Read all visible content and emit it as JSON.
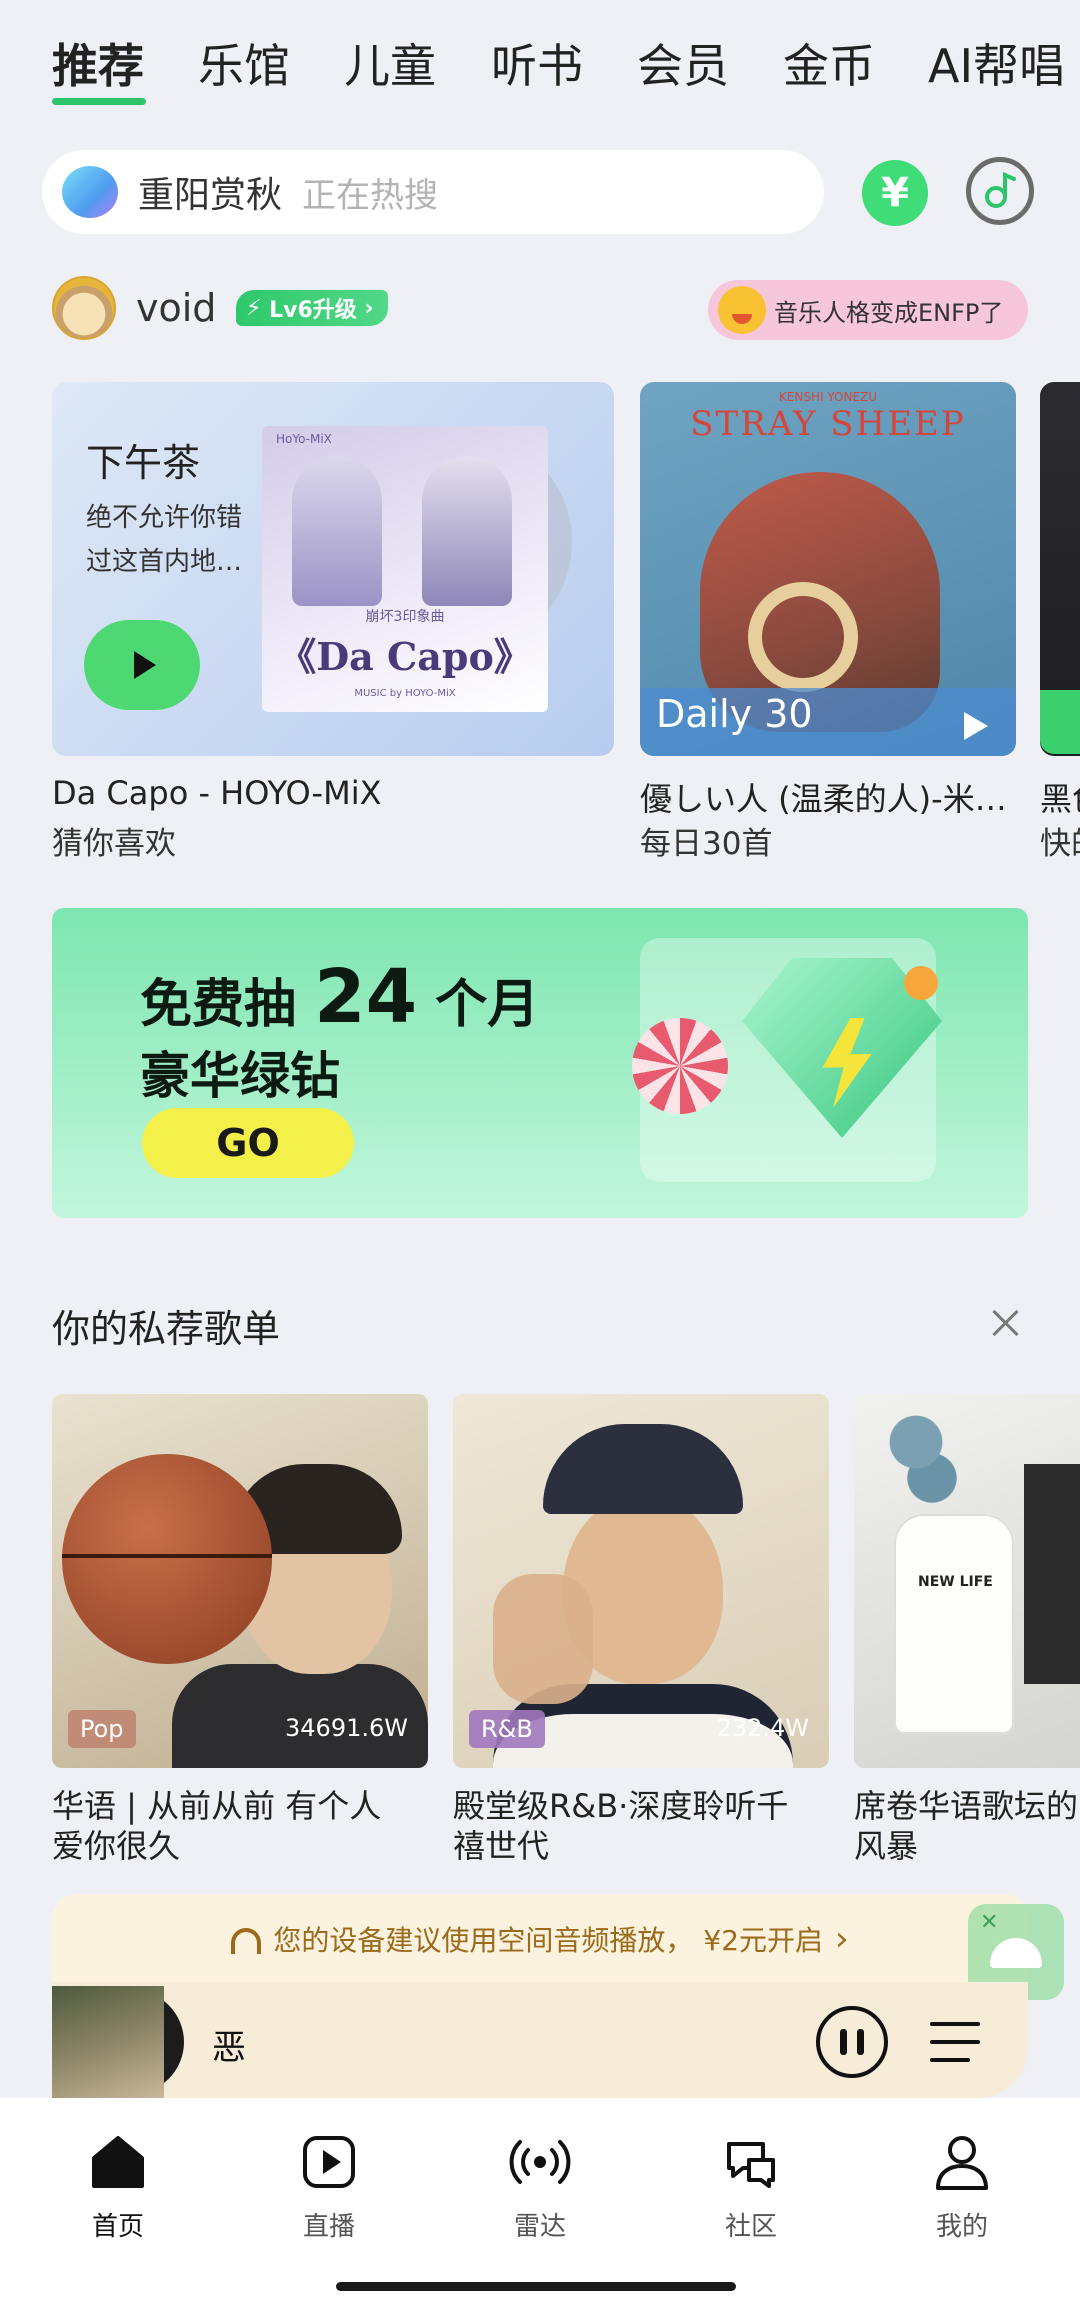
{
  "top_tabs": [
    "推荐",
    "乐馆",
    "儿童",
    "听书",
    "会员",
    "金币",
    "AI帮唱"
  ],
  "active_tab": "推荐",
  "search": {
    "keyword": "重阳赏秋",
    "hint": "正在热搜"
  },
  "coin_icon": "yen-icon",
  "user": {
    "name": "void",
    "level": "Lv6升级",
    "persona": "音乐人格变成ENFP了"
  },
  "cards": [
    {
      "title": "下午茶",
      "desc": "绝不允许你错过这首内地…",
      "cover_caption": "崩坏3印象曲",
      "cover_title": "《Da Capo》",
      "cover_foot": "MUSIC by HOYO-MiX",
      "cover_brand": "HoYo-MiX",
      "line1": "Da Capo - HOYO-MiX",
      "line2": "猜你喜欢"
    },
    {
      "cover_title": "STRAY SHEEP",
      "cover_brand": "KENSHI YONEZU",
      "label": "Daily 30",
      "line1": "優しい人 (温柔的人)-米…",
      "line2": "每日30首"
    },
    {
      "line1": "黑色",
      "line2": "快的"
    }
  ],
  "banner": {
    "line1_prefix": "免费抽",
    "line1_number": "24",
    "line1_suffix": "个月",
    "line2": "豪华绿钻",
    "button": "GO"
  },
  "section": {
    "title": "你的私荐歌单"
  },
  "playlists": [
    {
      "tag": "Pop",
      "count": "34691.6W",
      "caption_line1": "华语 | 从前从前 有个人",
      "caption_line2": "爱你很久"
    },
    {
      "tag": "R&B",
      "count": "232.4W",
      "caption_line1": "殿堂级R&B·深度聆听千",
      "caption_line2": "禧世代"
    },
    {
      "tag": "",
      "count": "",
      "bottle_label": "NEW LIFE",
      "caption_line1": "席卷华语歌坛的",
      "caption_line2": "风暴"
    }
  ],
  "spatial_audio": {
    "text": "您的设备建议使用空间音频播放，",
    "price": "¥2元开启",
    "chevron": "›"
  },
  "player": {
    "title": "恶"
  },
  "bottom_nav": [
    {
      "label": "首页",
      "icon": "home-icon",
      "active": true
    },
    {
      "label": "直播",
      "icon": "live-play-icon",
      "active": false
    },
    {
      "label": "雷达",
      "icon": "radar-icon",
      "active": false
    },
    {
      "label": "社区",
      "icon": "community-chat-icon",
      "active": false
    },
    {
      "label": "我的",
      "icon": "profile-icon",
      "active": false
    }
  ],
  "colors": {
    "accent": "#2ec46c",
    "background": "#eef0f5",
    "banner": "#7de6b0",
    "player_bg": "#f7ecd8"
  }
}
